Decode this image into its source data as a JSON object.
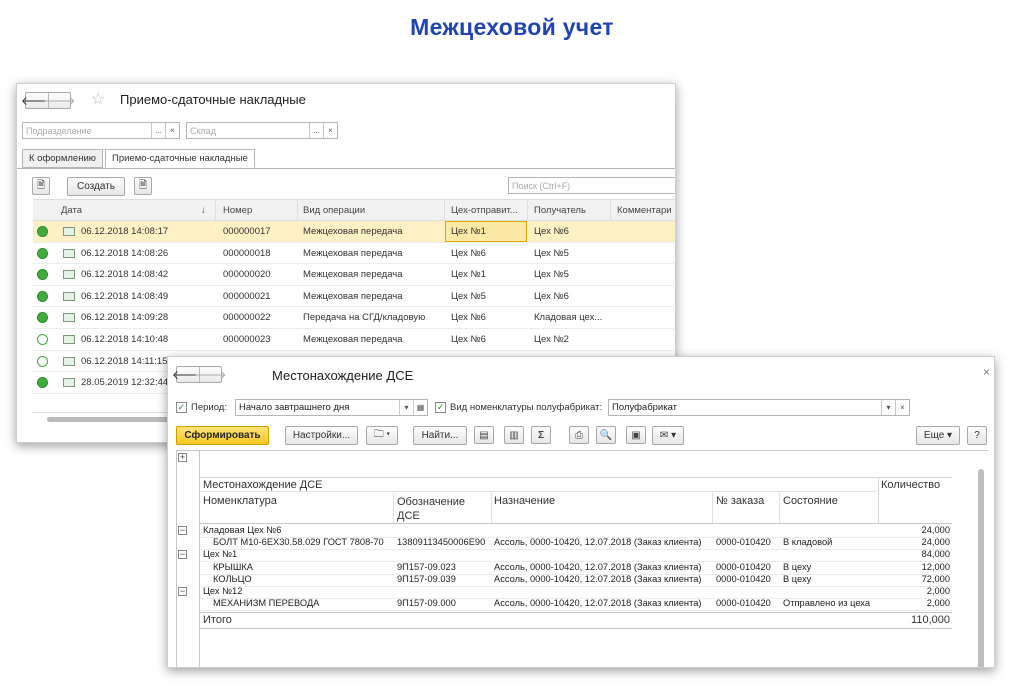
{
  "page_title": "Межцеховой учет",
  "win1": {
    "title": "Приемо-сдаточные накладные",
    "filter_dept_placeholder": "Подразделение",
    "filter_store_placeholder": "Склад",
    "btn_dots": "...",
    "btn_clear": "×",
    "tabs": [
      "К оформлению",
      "Приемо-сдаточные накладные"
    ],
    "create_label": "Создать",
    "search_placeholder": "Поиск (Ctrl+F)",
    "columns": [
      "Дата",
      "Номер",
      "Вид операции",
      "Цех-отправит...",
      "Получатель",
      "Комментари"
    ],
    "sort_arrow": "↓",
    "rows": [
      {
        "status": "posted",
        "date": "06.12.2018 14:08:17",
        "num": "000000017",
        "op": "Межцеховая передача",
        "from": "Цех №1",
        "to": "Цех №6"
      },
      {
        "status": "posted",
        "date": "06.12.2018 14:08:26",
        "num": "000000018",
        "op": "Межцеховая передача",
        "from": "Цех №6",
        "to": "Цех №5"
      },
      {
        "status": "posted",
        "date": "06.12.2018 14:08:42",
        "num": "000000020",
        "op": "Межцеховая передача",
        "from": "Цех №1",
        "to": "Цех №5"
      },
      {
        "status": "posted",
        "date": "06.12.2018 14:08:49",
        "num": "000000021",
        "op": "Межцеховая передача",
        "from": "Цех №5",
        "to": "Цех №6"
      },
      {
        "status": "posted",
        "date": "06.12.2018 14:09:28",
        "num": "000000022",
        "op": "Передача на СГД/кладовую",
        "from": "Цех №6",
        "to": "Кладовая цех..."
      },
      {
        "status": "draft",
        "date": "06.12.2018 14:10:48",
        "num": "000000023",
        "op": "Межцеховая передача",
        "from": "Цех №6",
        "to": "Цех №2"
      },
      {
        "status": "draft",
        "date": "06.12.2018 14:11:15",
        "num": "",
        "op": "",
        "from": "",
        "to": ""
      },
      {
        "status": "posted",
        "date": "28.05.2019 12:32:44",
        "num": "",
        "op": "",
        "from": "",
        "to": ""
      }
    ]
  },
  "win2": {
    "title": "Местонахождение ДСЕ",
    "close": "×",
    "period_label": "Период:",
    "period_value": "Начало завтрашнего дня",
    "nomen_label": "Вид номенклатуры полуфабрикат:",
    "nomen_value": "Полуфабрикат",
    "btn_generate": "Сформировать",
    "btn_settings": "Настройки...",
    "btn_find": "Найти...",
    "btn_more": "Еще",
    "btn_help": "?",
    "sigma": "Σ",
    "report": {
      "title": "Местонахождение ДСЕ",
      "headers": {
        "nom": "Номенклатура",
        "code": "Обозначение ДСЕ",
        "dest": "Назначение",
        "order": "№ заказа",
        "state": "Состояние",
        "qty": "Количество"
      },
      "rows": [
        {
          "level": 0,
          "nom": "Кладовая Цех №6",
          "code": "",
          "dest": "",
          "order": "",
          "state": "",
          "qty": "24,000"
        },
        {
          "level": 1,
          "nom": "БОЛТ М10-6ЕХ30.58.029 ГОСТ 7808-70",
          "code": "13809113450006Е90",
          "dest": "Ассоль, 0000-10420, 12.07.2018 (Заказ клиента)",
          "order": "0000-010420",
          "state": "В кладовой",
          "qty": "24,000"
        },
        {
          "level": 0,
          "nom": "Цех №1",
          "code": "",
          "dest": "",
          "order": "",
          "state": "",
          "qty": "84,000"
        },
        {
          "level": 1,
          "nom": "КРЫШКА",
          "code": "9П157-09.023",
          "dest": "Ассоль, 0000-10420, 12.07.2018 (Заказ клиента)",
          "order": "0000-010420",
          "state": "В цеху",
          "qty": "12,000"
        },
        {
          "level": 1,
          "nom": "КОЛЬЦО",
          "code": "9П157-09.039",
          "dest": "Ассоль, 0000-10420, 12.07.2018 (Заказ клиента)",
          "order": "0000-010420",
          "state": "В цеху",
          "qty": "72,000"
        },
        {
          "level": 0,
          "nom": "Цех №12",
          "code": "",
          "dest": "",
          "order": "",
          "state": "",
          "qty": "2,000"
        },
        {
          "level": 1,
          "nom": "МЕХАНИЗМ ПЕРЕВОДА",
          "code": "9П157-09.000",
          "dest": "Ассоль, 0000-10420, 12.07.2018 (Заказ клиента)",
          "order": "0000-010420",
          "state": "Отправлено из цеха",
          "qty": "2,000"
        }
      ],
      "total_label": "Итого",
      "total_qty": "110,000"
    }
  }
}
